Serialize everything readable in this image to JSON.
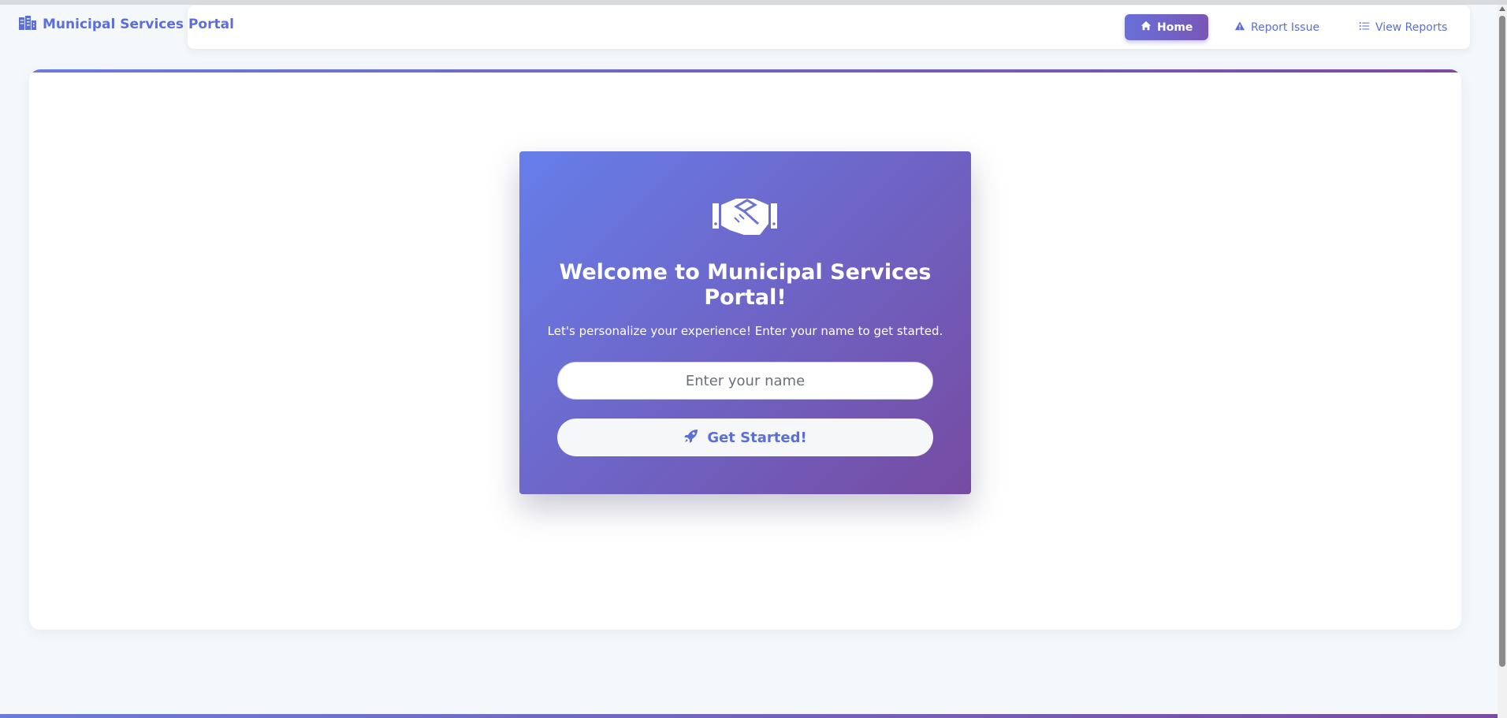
{
  "brand": {
    "title": "Municipal Services Portal",
    "icon": "city-icon"
  },
  "nav": {
    "items": [
      {
        "label": "Home",
        "icon": "home-icon",
        "active": true
      },
      {
        "label": "Report Issue",
        "icon": "warning-icon",
        "active": false
      },
      {
        "label": "View Reports",
        "icon": "list-icon",
        "active": false
      }
    ]
  },
  "welcome": {
    "icon": "handshake-icon",
    "title": "Welcome to Municipal Services Portal!",
    "subtitle": "Let's personalize your experience! Enter your name to get started.",
    "name_placeholder": "Enter your name",
    "name_value": "",
    "button_label": "Get Started!",
    "button_icon": "rocket-icon"
  },
  "colors": {
    "accent": "#5b6fd6",
    "gradient_start": "#667eea",
    "gradient_end": "#764ba2",
    "background": "#f5f8fb"
  }
}
